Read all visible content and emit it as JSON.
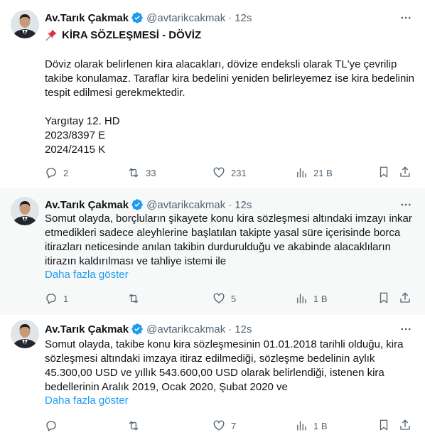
{
  "tweets": [
    {
      "author": {
        "name": "Av.Tarık Çakmak",
        "handle": "@avtarikcakmak",
        "time": "12s"
      },
      "title": "KİRA SÖZLEŞMESİ - DÖVİZ",
      "body": "Döviz olarak belirlenen kira alacakları, dövize endeksli olarak TL'ye çevrilip takibe konulamaz. Taraflar kira bedelini yeniden belirleyemez ise kira bedelinin tespit edilmesi gerekmektedir.\n\nYargıtay 12. HD\n2023/8397 E\n2024/2415 K",
      "stats": {
        "replies": "2",
        "retweets": "33",
        "likes": "231",
        "views": "21 B"
      }
    },
    {
      "author": {
        "name": "Av.Tarık Çakmak",
        "handle": "@avtarikcakmak",
        "time": "12s"
      },
      "body": "Somut olayda, borçluların şikayete konu kira sözleşmesi altındaki imzayı inkar etmedikleri sadece aleyhlerine başlatılan takipte yasal süre içerisinde borca itirazları neticesinde anılan takibin durdurulduğu ve akabinde alacaklıların itirazın kaldırılması ve tahliye istemi ile",
      "show_more": "Daha fazla göster",
      "stats": {
        "replies": "1",
        "retweets": "",
        "likes": "5",
        "views": "1 B"
      }
    },
    {
      "author": {
        "name": "Av.Tarık Çakmak",
        "handle": "@avtarikcakmak",
        "time": "12s"
      },
      "body": "Somut olayda, takibe konu kira sözleşmesinin 01.01.2018 tarihli olduğu, kira sözleşmesi altındaki imzaya itiraz edilmediği, sözleşme bedelinin aylık 45.300,00 USD ve yıllık 543.600,00 USD olarak belirlendiği, istenen kira bedellerinin Aralık 2019, Ocak 2020, Şubat 2020 ve",
      "show_more": "Daha fazla göster",
      "stats": {
        "replies": "",
        "retweets": "",
        "likes": "7",
        "views": "1 B"
      }
    }
  ],
  "colors": {
    "text": "#0f1419",
    "muted": "#536471",
    "link": "#1d9bf0",
    "verified": "#1d9bf0",
    "thread_line": "#cfd9de",
    "highlight_bg": "#f7f9f9"
  },
  "icons": [
    "verified-badge-icon",
    "more-icon",
    "pin-icon",
    "reply-icon",
    "retweet-icon",
    "like-icon",
    "views-icon",
    "bookmark-icon",
    "share-icon"
  ]
}
